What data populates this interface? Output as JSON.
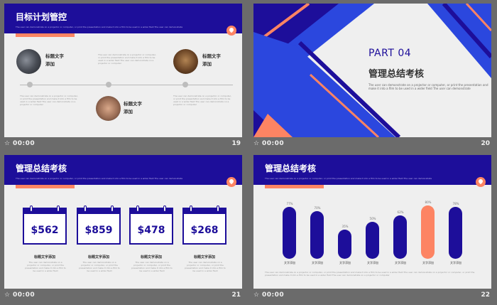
{
  "colors": {
    "navy": "#1d0e9a",
    "coral": "#fd8463",
    "blue": "#2b47de",
    "bg": "#efefef"
  },
  "footer": {
    "star_icon": "star-icon",
    "time": "00:00"
  },
  "slides": [
    {
      "number": "19",
      "title": "目标计划管控",
      "subtitle": "The user can demonstrate on a projector or computer, or print the presentation and make it into a film to be used in a wider field The user can demonstrate",
      "items": [
        {
          "label_line1": "标题文字",
          "label_line2": "添加"
        },
        {
          "label_line1": "标题文字",
          "label_line2": "添加"
        },
        {
          "label_line1": "标题文字",
          "label_line2": "添加"
        }
      ],
      "body": "The user can demonstrate on a projector or computer, or print the presentation and make it into a film to be used in a wider field The user can demonstrate on a projector or computer"
    },
    {
      "number": "20",
      "part": "PART 04",
      "title": "管理总结考核",
      "body": "The user can demonstrate on a projector or computer, or print the presentation and make it into a film to be used in a wider field The user can demonstrate"
    },
    {
      "number": "21",
      "title": "管理总结考核",
      "subtitle": "The user can demonstrate on a projector or computer, or print the presentation and make it into a film to be used in a wider field The user can demonstrate",
      "cards": [
        {
          "price": "$562",
          "label": "标题文字添加"
        },
        {
          "price": "$859",
          "label": "标题文字添加"
        },
        {
          "price": "$478",
          "label": "标题文字添加"
        },
        {
          "price": "$268",
          "label": "标题文字添加"
        }
      ],
      "card_body": "The user can demonstrate on a projector or computer, or print the presentation and make it into a film to be used in a wider field"
    },
    {
      "number": "22",
      "title": "管理总结考核",
      "subtitle": "The user can demonstrate on a projector or computer, or print the presentation and make it into a film to be used in a wider field The user can demonstrate",
      "body": "The user can demonstrate on a projector or computer, or print the presentation and make it into a film to be used in a wider field The user can demonstrate on a projector or computer, or print the presentation and make it into a film to be used in a wider field The user can demonstrate on a projector or computer"
    }
  ],
  "chart_data": {
    "type": "bar",
    "categories": [
      "文字添加",
      "文字添加",
      "文字添加",
      "文字添加",
      "文字添加",
      "文字添加",
      "文字添加"
    ],
    "values": [
      77,
      70,
      35,
      50,
      62,
      80,
      78
    ],
    "value_labels": [
      "77%",
      "70%",
      "35%",
      "50%",
      "62%",
      "80%",
      "78%"
    ],
    "highlight_index": 5,
    "ylim": [
      0,
      100
    ],
    "title": "",
    "xlabel": "",
    "ylabel": ""
  }
}
